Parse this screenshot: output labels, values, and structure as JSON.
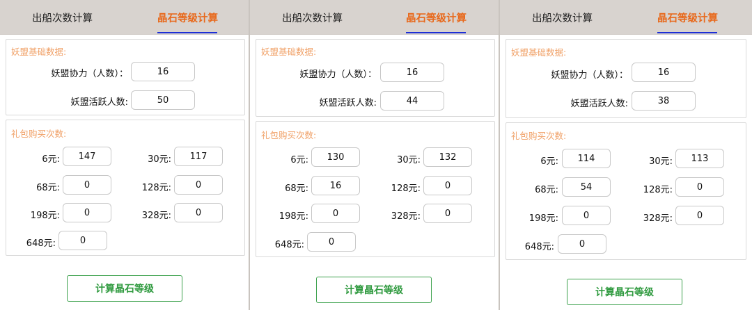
{
  "tabs": {
    "ship_count": "出船次数计算",
    "crystal_level": "晶石等级计算"
  },
  "basic_group_title": "妖盟基础数据:",
  "purchase_group_title": "礼包购买次数:",
  "labels": {
    "assist": "妖盟协力（人数）：",
    "active": "妖盟活跃人数:",
    "p6": "6元:",
    "p30": "30元:",
    "p68": "68元:",
    "p128": "128元:",
    "p198": "198元:",
    "p328": "328元:",
    "p648": "648元:"
  },
  "calc_button": "计算晶石等级",
  "panels": [
    {
      "assist": "16",
      "active": "50",
      "p6": "147",
      "p30": "117",
      "p68": "0",
      "p128": "0",
      "p198": "0",
      "p328": "0",
      "p648": "0"
    },
    {
      "assist": "16",
      "active": "44",
      "p6": "130",
      "p30": "132",
      "p68": "16",
      "p128": "0",
      "p198": "0",
      "p328": "0",
      "p648": "0"
    },
    {
      "assist": "16",
      "active": "38",
      "p6": "114",
      "p30": "113",
      "p68": "54",
      "p128": "0",
      "p198": "0",
      "p328": "0",
      "p648": "0"
    }
  ]
}
